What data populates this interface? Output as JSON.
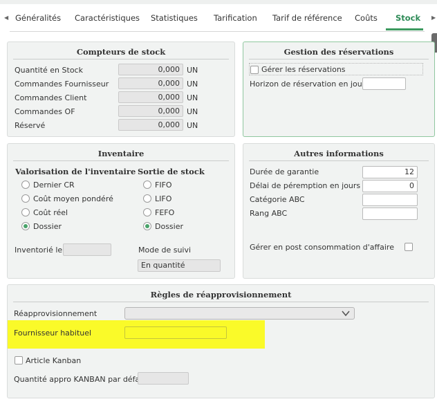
{
  "tabs": [
    {
      "label": "Généralités"
    },
    {
      "label": "Caractéristiques"
    },
    {
      "label": "Statistiques"
    },
    {
      "label": "Tarification"
    },
    {
      "label": "Tarif de référence"
    },
    {
      "label": "Coûts"
    },
    {
      "label": "Stock",
      "active": true
    }
  ],
  "compteurs": {
    "title": "Compteurs de stock",
    "rows": [
      {
        "label": "Quantité en Stock",
        "value": "0,000",
        "unit": "UN"
      },
      {
        "label": "Commandes Fournisseur",
        "value": "0,000",
        "unit": "UN"
      },
      {
        "label": "Commandes Client",
        "value": "0,000",
        "unit": "UN"
      },
      {
        "label": "Commandes OF",
        "value": "0,000",
        "unit": "UN"
      },
      {
        "label": "Réservé",
        "value": "0,000",
        "unit": "UN"
      }
    ]
  },
  "reservations": {
    "title": "Gestion des réservations",
    "checkbox_label": "Gérer les réservations",
    "checked": false,
    "horizon_label": "Horizon de réservation en jour",
    "horizon_value": ""
  },
  "inventaire": {
    "title": "Inventaire",
    "valorisation_header": "Valorisation de l'inventaire",
    "valorisation_options": [
      "Dernier CR",
      "Coût moyen pondéré",
      "Coût réel",
      "Dossier"
    ],
    "valorisation_selected": "Dossier",
    "sortie_header": "Sortie de stock",
    "sortie_options": [
      "FIFO",
      "LIFO",
      "FEFO",
      "Dossier"
    ],
    "sortie_selected": "Dossier",
    "inventorie_label": "Inventorié le",
    "inventorie_value": "",
    "mode_label": "Mode de suivi",
    "mode_value": "En quantité"
  },
  "autres": {
    "title": "Autres informations",
    "garantie_label": "Durée de garantie",
    "garantie_value": "12",
    "peremption_label": "Délai de péremption en jours",
    "peremption_value": "0",
    "abc_label": "Catégorie ABC",
    "abc_value": "",
    "rang_label": "Rang ABC",
    "rang_value": "",
    "post_conso_label": "Gérer en post consommation d'affaire",
    "post_conso_checked": false
  },
  "regles": {
    "title": "Règles de réapprovisionnement",
    "reappro_label": "Réapprovisionnement",
    "reappro_value": "",
    "fournisseur_label": "Fournisseur habituel",
    "fournisseur_value": "",
    "kanban_label": "Article Kanban",
    "kanban_checked": false,
    "qte_kanban_label": "Quantité appro KANBAN par défaut",
    "qte_kanban_value": ""
  },
  "colors": {
    "accent": "#3c9a5f",
    "highlight": "#fafa29",
    "panel_bg": "#f1f3f2"
  }
}
